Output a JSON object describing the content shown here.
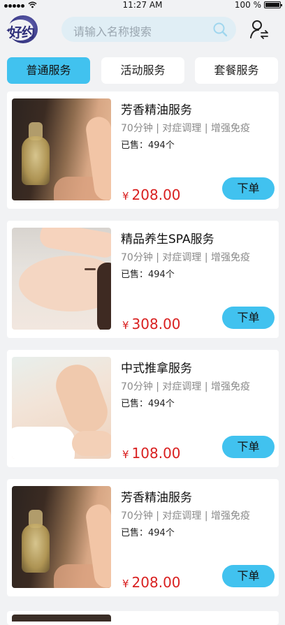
{
  "status_bar": {
    "time": "11:27 AM",
    "battery": "100 %"
  },
  "header": {
    "logo_text": "好约",
    "search_placeholder": "请输入名称搜索"
  },
  "tabs": [
    {
      "label": "普通服务",
      "active": true
    },
    {
      "label": "活动服务",
      "active": false
    },
    {
      "label": "套餐服务",
      "active": false
    }
  ],
  "accent_color": "#41c2ef",
  "price_color": "#d92020",
  "products": [
    {
      "title": "芳香精油服务",
      "tags": "70分钟 | 对症调理 | 增强免疫",
      "sold": "已售：494个",
      "currency": "¥",
      "price": "208.00",
      "order_label": "下单",
      "image": "aroma-oil-photo"
    },
    {
      "title": "精品养生SPA服务",
      "tags": "70分钟 | 对症调理 | 增强免疫",
      "sold": "已售：494个",
      "currency": "¥",
      "price": "308.00",
      "order_label": "下单",
      "image": "face-spa-photo"
    },
    {
      "title": "中式推拿服务",
      "tags": "70分钟 | 对症调理 | 增强免疫",
      "sold": "已售：494个",
      "currency": "¥",
      "price": "108.00",
      "order_label": "下单",
      "image": "massage-photo"
    },
    {
      "title": "芳香精油服务",
      "tags": "70分钟 | 对症调理 | 增强免疫",
      "sold": "已售：494个",
      "currency": "¥",
      "price": "208.00",
      "order_label": "下单",
      "image": "aroma-oil-photo"
    }
  ]
}
